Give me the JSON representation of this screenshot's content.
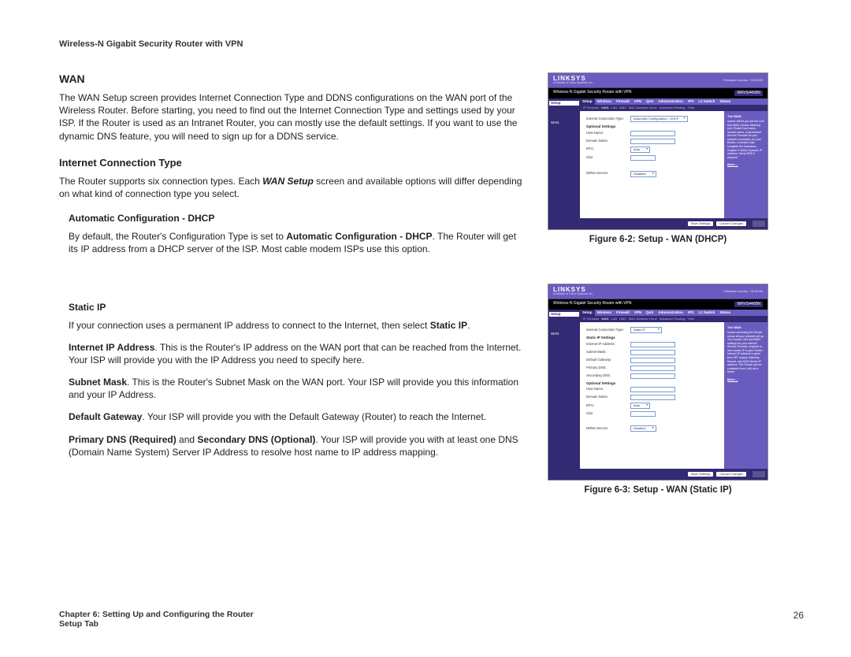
{
  "doc_header": "Wireless-N Gigabit Security Router with VPN",
  "h_wan": "WAN",
  "p_wan": "The WAN Setup screen provides Internet Connection Type and DDNS configurations on the WAN port of the Wireless Router. Before starting, you need to find out the Internet Connection Type and settings used by your ISP. If the Router is used as an Intranet Router, you can mostly use the default settings. If you want to use the dynamic DNS feature, you will need to sign up for a DDNS service.",
  "h_ict": "Internet Connection Type",
  "p_ict_a": "The Router supports six connection types. Each ",
  "p_ict_i": "WAN Setup",
  "p_ict_b": " screen and available options will differ depending on what kind of connection type you select.",
  "h_dhcp": "Automatic Configuration - DHCP",
  "p_dhcp_a": "By default, the Router's Configuration Type is set to ",
  "p_dhcp_b": "Automatic Configuration - DHCP",
  "p_dhcp_c": ". The Router will get its IP address from a DHCP server of the ISP. Most cable modem ISPs use this option.",
  "h_static": "Static IP",
  "p_static_a": "If your connection uses a permanent IP address to connect to the Internet, then select ",
  "p_static_b": "Static IP",
  "p_static_c": ".",
  "p_ip_a": "Internet IP Address",
  "p_ip_b": ". This is the Router's IP address on the WAN port that can be reached from the Internet. Your ISP will provide you with the IP Address you need to specify here.",
  "p_sm_a": "Subnet Mask",
  "p_sm_b": ". This is the Router's Subnet Mask on the WAN port. Your ISP will provide you this information and your IP Address.",
  "p_dg_a": "Default Gateway",
  "p_dg_b": ". Your ISP will provide you with the Default Gateway (Router) to reach the Internet.",
  "p_dns_a": "Primary DNS (Required)",
  "p_dns_b": " and ",
  "p_dns_c": "Secondary DNS (Optional)",
  "p_dns_d": ". Your ISP will provide you with at least one DNS (Domain Name System) Server IP Address to resolve host name to IP address mapping.",
  "fig1": {
    "caption": "Figure 6-2: Setup - WAN (DHCP)",
    "brand": "LINKSYS",
    "brand_sub": "A Division of Cisco Systems, Inc.",
    "fw": "Firmware version : 00.00.00",
    "title": "Wireless-N Gigabit Security Router with VPN",
    "model": "WRVS4400N",
    "side_sel": "Setup",
    "side_sub": "WAN",
    "tabs": [
      "Setup",
      "Wireless",
      "Firewall",
      "VPN",
      "QoS",
      "Administration",
      "IPS",
      "L2 Switch",
      "Status"
    ],
    "subtabs": [
      "IP Versions",
      "WAN",
      "LAN",
      "DMZ",
      "MAC Address Clone",
      "Advanced Routing",
      "Time"
    ],
    "f_ict_label": "Internet Connection Type:",
    "f_ict_val": "Automatic Configuration - DHCP",
    "f_opt": "Optional Settings",
    "f_host": "Host Name:",
    "f_domain": "Domain Name:",
    "f_mtu": "MTU:",
    "f_mtu_val": "Auto",
    "f_size": "Size:",
    "f_ddns": "DDNS Service:",
    "f_ddns_val": "Disabled",
    "help_title": "The WAN",
    "help_body": "screen will let you set the LAN and WAN; choose listening port, Router host name, domain name, local Internet Service Provider for your network connection on your Router, if needed. Also complete the hostname, Chapter 6 WAN; Dynamic IP address, Setup DNS if required.",
    "help_more": "More…",
    "btn_save": "Save Settings",
    "btn_cancel": "Cancel Changes"
  },
  "fig2": {
    "caption": "Figure 6-3: Setup - WAN (Static IP)",
    "brand": "LINKSYS",
    "brand_sub": "A Division of Cisco Systems, Inc.",
    "fw": "Firmware version : 00.00.00",
    "title": "Wireless-N Gigabit Security Router with VPN",
    "model": "WRVS4400N",
    "side_sel": "Setup",
    "side_sub": "WAN",
    "tabs": [
      "Setup",
      "Wireless",
      "Firewall",
      "VPN",
      "QoS",
      "Administration",
      "IPS",
      "L2 Switch",
      "Status"
    ],
    "subtabs": [
      "IP Versions",
      "WAN",
      "LAN",
      "DMZ",
      "MAC Address Clone",
      "Advanced Routing",
      "Time"
    ],
    "f_ict_label": "Internet Connection Type:",
    "f_ict_val": "Static IP",
    "f_static": "Static IP Settings",
    "f_ip": "Internet IP Address:",
    "f_sm": "Subnet Mask:",
    "f_gw": "Default Gateway:",
    "f_pdns": "Primary DNS:",
    "f_sdns": "Secondary DNS:",
    "f_opt": "Optional Settings",
    "f_host": "Host Name:",
    "f_domain": "Domain Name:",
    "f_mtu": "MTU:",
    "f_mtu_val": "Auto",
    "f_size": "Size:",
    "f_ddns": "DDNS Service:",
    "f_ddns_val": "Disabled",
    "help_title": "The WAN",
    "help_body": "screen accessing the Router shows all your network set up. You choose LAN and WAN settings for your Internet Service Provider; requires to use a static IP in your Router. Internet IP address is given from ISP; supply Gateway, Subnet, and DNS Server IP address. The Router can be contacted from LAN via a telnet.",
    "help_more": "More…",
    "btn_save": "Save Settings",
    "btn_cancel": "Cancel Changes"
  },
  "footer_chapter": "Chapter 6: Setting Up and Configuring the Router",
  "footer_tab": "Setup Tab",
  "page_num": "26"
}
